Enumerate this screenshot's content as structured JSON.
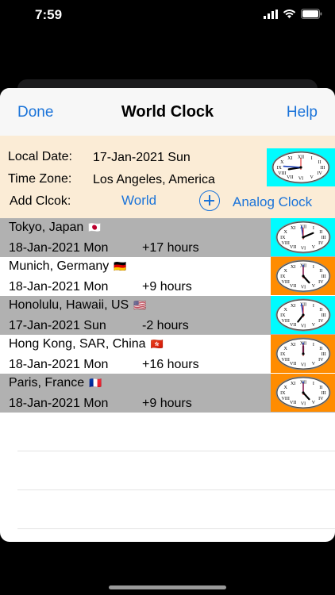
{
  "status_bar": {
    "time": "7:59"
  },
  "nav": {
    "done_label": "Done",
    "title": "World Clock",
    "help_label": "Help"
  },
  "local": {
    "date_label": "Local Date:",
    "date_value": "17-Jan-2021 Sun",
    "tz_label": "Time Zone:",
    "tz_value": "Los Angeles, America",
    "add_label": "Add Clcok:",
    "world_link": "World",
    "analog_link": "Analog Clock"
  },
  "clocks": [
    {
      "city": "Tokyo, Japan",
      "flag": "🇯🇵",
      "date": "18-Jan-2021 Mon",
      "offset": "+17 hours",
      "row_color": "#b1b1b1",
      "clock_bg": "#00fcff",
      "hour": 0.9,
      "minute": 59
    },
    {
      "city": "Munich, Germany",
      "flag": "🇩🇪",
      "date": "18-Jan-2021 Mon",
      "offset": "+9 hours",
      "row_color": "#ffffff",
      "clock_bg": "#ff8c00",
      "hour": 5,
      "minute": 0
    },
    {
      "city": "Honolulu, Hawaii, US",
      "flag": "🇺🇸",
      "date": "17-Jan-2021 Sun",
      "offset": "-2 hours",
      "row_color": "#b1b1b1",
      "clock_bg": "#00fcff",
      "hour": 5.9,
      "minute": 59
    },
    {
      "city": "Hong Kong, SAR, China",
      "flag": "🇭🇰",
      "date": "18-Jan-2021 Mon",
      "offset": "+16 hours",
      "row_color": "#ffffff",
      "clock_bg": "#ff8c00",
      "hour": 12,
      "minute": 0
    },
    {
      "city": "Paris, France",
      "flag": "🇫🇷",
      "date": "18-Jan-2021 Mon",
      "offset": "+9 hours",
      "row_color": "#b1b1b1",
      "clock_bg": "#ff8c00",
      "hour": 5,
      "minute": 0
    }
  ],
  "colors": {
    "accent": "#1a73d9",
    "local_panel_bg": "#fbecd6",
    "nav_bg": "#f7f7f7"
  },
  "icons": {
    "status": [
      "signal-icon",
      "wifi-icon",
      "battery-icon"
    ],
    "add": "plus-circle-icon"
  }
}
